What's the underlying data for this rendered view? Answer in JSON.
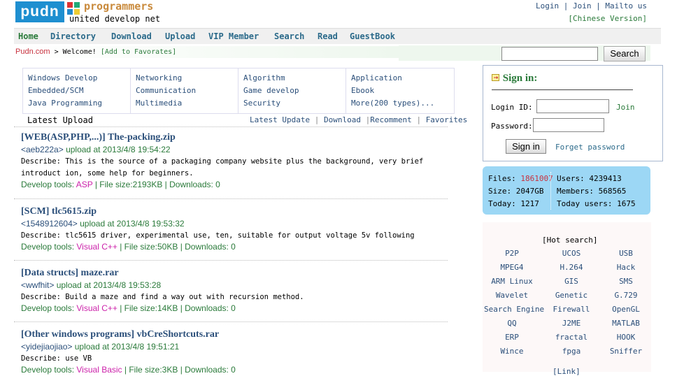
{
  "header": {
    "logo_text": "pudn",
    "brand": "programmers",
    "tagline": "united develop net",
    "top_links": [
      "Login",
      "Join",
      "Mailto us"
    ],
    "chinese_version": "[Chinese Version]"
  },
  "nav": [
    "Home",
    "Directory",
    "Download",
    "Upload",
    "VIP Member",
    "Search",
    "Read",
    "GuestBook"
  ],
  "breadcrumb": {
    "site": "Pudn.com",
    "sep": ">",
    "welcome": "Welcome!",
    "favorites": "[Add to Favorates]"
  },
  "search": {
    "value": "",
    "button": "Search"
  },
  "categories": [
    [
      "Windows Develop",
      "Embedded/SCM",
      "Java Programming"
    ],
    [
      "Networking",
      "Communication",
      "Multimedia"
    ],
    [
      "Algorithm",
      "Game develop",
      "Security"
    ],
    [
      "Application",
      "Ebook",
      "More(200 types)..."
    ]
  ],
  "latest": {
    "tab": "Latest Upload",
    "links": [
      "Latest Update",
      "Download",
      "Recomment",
      "Favorites"
    ]
  },
  "entries": [
    {
      "title": "[WEB(ASP,PHP,...)] The-packing.zip",
      "user": "<aeb222a>",
      "uploaded": " upload at 2013/4/8 19:54:22",
      "desc": "Describe: This is the source of a packaging company website plus the background, very brief introduct ion, some help for beginners.",
      "tools_label": "Develop tools: ",
      "lang": "ASP",
      "rest": " | File size:2193KB | Downloads: 0"
    },
    {
      "title": "[SCM] tlc5615.zip",
      "user": "<1548912604>",
      "uploaded": " upload at 2013/4/8 19:53:32",
      "desc": "Describe: tlc5615 driver, experimental use, ten, suitable for output voltage 5v following",
      "tools_label": "Develop tools: ",
      "lang": "Visual C++",
      "rest": " | File size:50KB | Downloads: 0"
    },
    {
      "title": "[Data structs] maze.rar",
      "user": "<wwfhit>",
      "uploaded": " upload at 2013/4/8 19:53:28",
      "desc": "Describe: Build a maze and find a way out with recursion method.",
      "tools_label": "Develop tools: ",
      "lang": "Visual C++",
      "rest": " | File size:14KB | Downloads: 0"
    },
    {
      "title": "[Other windows programs] vbCreShortcuts.rar",
      "user": "<yidejiaojiao>",
      "uploaded": " upload at 2013/4/8 19:51:21",
      "desc": "Describe: use VB",
      "tools_label": "Develop tools: ",
      "lang": "Visual Basic",
      "rest": " | File size:3KB | Downloads: 0"
    }
  ],
  "signin": {
    "title": "Sign in:",
    "login_label": "Login ID:",
    "join": "Join",
    "password_label": "Password:",
    "button": "Sign in",
    "forgot": "Forget password"
  },
  "stats": {
    "files_label": "Files:",
    "files": "1861007",
    "users": "Users: 4239413",
    "size": "Size: 2047GB",
    "members": "Members: 568565",
    "today": "Today: 1217",
    "today_users": "Today users: 1675"
  },
  "hot_search": {
    "title": "[Hot search]",
    "items": [
      [
        "P2P",
        "UCOS",
        "USB"
      ],
      [
        "MPEG4",
        "H.264",
        "Hack"
      ],
      [
        "ARM Linux",
        "GIS",
        "SMS"
      ],
      [
        "Wavelet",
        "Genetic",
        "G.729"
      ],
      [
        "Search Engine",
        "Firewall",
        "OpenGL"
      ],
      [
        "QQ",
        "J2ME",
        "MATLAB"
      ],
      [
        "ERP",
        "fractal",
        "HOOK"
      ],
      [
        "Wince",
        "fpga",
        "Sniffer"
      ]
    ],
    "more": "[Link]"
  },
  "colors": {
    "logo_bg": "#1e8fd0",
    "link_blue": "#2b4f7a",
    "green": "#2a7a3a",
    "magenta": "#cc22aa",
    "red": "#c8313e",
    "stats_bg": "#9cd7f5"
  }
}
